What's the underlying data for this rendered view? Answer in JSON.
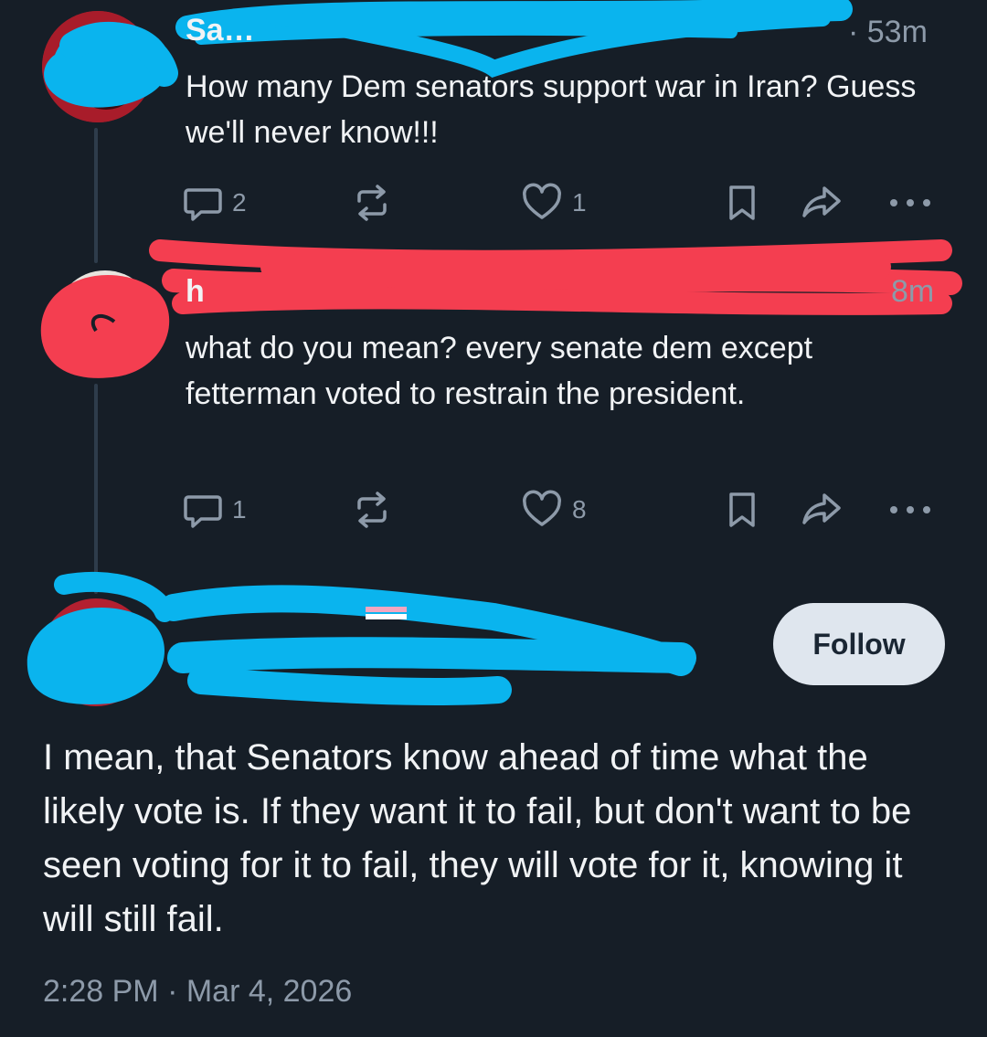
{
  "post1": {
    "header_visible": "Sa…",
    "time_label": "· 53m",
    "text": "How many Dem senators support war in Iran? Guess we'll never know!!!",
    "reply_count": "2",
    "like_count": "1"
  },
  "post2": {
    "header_visible": "h",
    "time_label": "8m",
    "text": "what do you mean? every senate dem except fetterman voted to restrain the president.",
    "reply_count": "1",
    "like_count": "8"
  },
  "main_post": {
    "follow_label": "Follow",
    "text": "I mean, that Senators know ahead of time what the likely vote is. If they want it to fail, but don't want to be seen voting for it to fail, they will vote for it, knowing it will still fail.",
    "timestamp": "2:28 PM · Mar 4, 2026"
  },
  "colors": {
    "background": "#161e27",
    "text_primary": "#f1f3f5",
    "text_secondary": "#8d9aa9",
    "follow_button_bg": "#dfe6ee",
    "redaction_blue": "#0ab4ee",
    "redaction_red": "#f43e50"
  },
  "icons": {
    "reply": "reply-icon",
    "repost": "repost-icon",
    "like": "heart-icon",
    "bookmark": "bookmark-icon",
    "share": "share-icon",
    "more": "more-icon"
  }
}
